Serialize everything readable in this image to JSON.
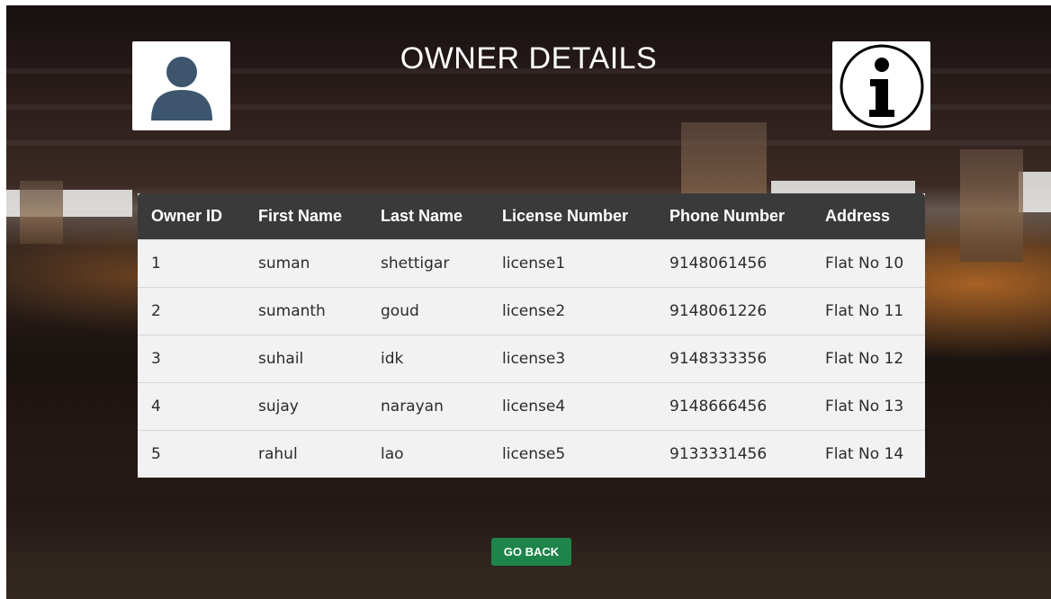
{
  "header": {
    "title": "OWNER DETAILS"
  },
  "icons": {
    "left": "user-avatar-icon",
    "right": "info-icon"
  },
  "table": {
    "columns": [
      "Owner ID",
      "First Name",
      "Last Name",
      "License Number",
      "Phone Number",
      "Address"
    ],
    "rows": [
      [
        "1",
        "suman",
        "shettigar",
        "license1",
        "9148061456",
        "Flat No 10"
      ],
      [
        "2",
        "sumanth",
        "goud",
        "license2",
        "9148061226",
        "Flat No 11"
      ],
      [
        "3",
        "suhail",
        "idk",
        "license3",
        "9148333356",
        "Flat No 12"
      ],
      [
        "4",
        "sujay",
        "narayan",
        "license4",
        "9148666456",
        "Flat No 13"
      ],
      [
        "5",
        "rahul",
        "lao",
        "license5",
        "9133331456",
        "Flat No 14"
      ]
    ]
  },
  "actions": {
    "go_back_label": "GO BACK"
  },
  "colors": {
    "header_bg": "#3a3a3a",
    "button_bg": "#1e8449",
    "row_bg": "#f2f2f2",
    "avatar": "#3d566e"
  }
}
